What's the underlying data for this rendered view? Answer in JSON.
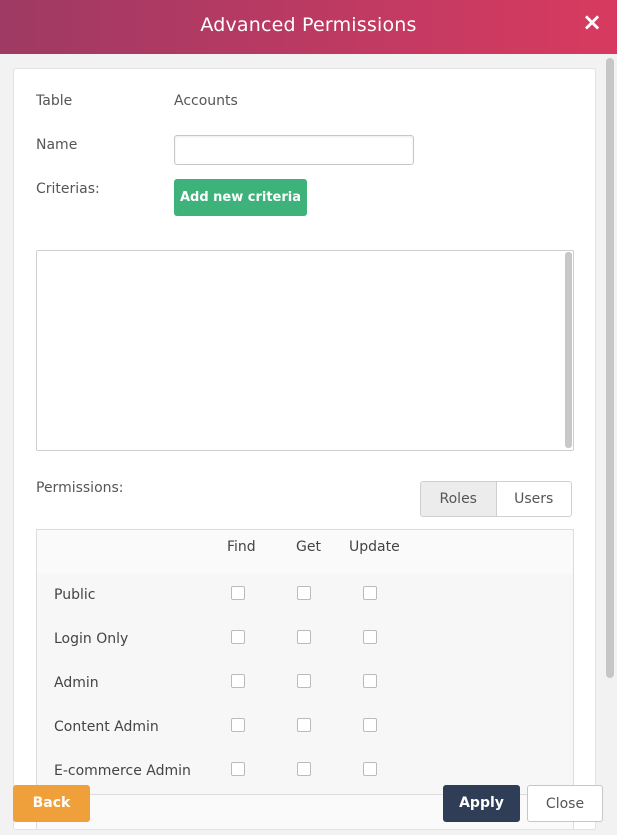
{
  "dialog": {
    "title": "Advanced Permissions",
    "close_icon": "×"
  },
  "form": {
    "table_label": "Table",
    "table_value": "Accounts",
    "name_label": "Name",
    "name_value": "",
    "name_placeholder": "",
    "criterias_label": "Criterias:",
    "add_criteria_label": "Add new criteria"
  },
  "permissions": {
    "label": "Permissions:",
    "toggle": {
      "roles": "Roles",
      "users": "Users",
      "selected": "Roles"
    },
    "columns": [
      "Find",
      "Get",
      "Update"
    ],
    "rows": [
      {
        "label": "Public",
        "find": false,
        "get": false,
        "update": false
      },
      {
        "label": "Login Only",
        "find": false,
        "get": false,
        "update": false
      },
      {
        "label": "Admin",
        "find": false,
        "get": false,
        "update": false
      },
      {
        "label": "Content Admin",
        "find": false,
        "get": false,
        "update": false
      },
      {
        "label": "E-commerce Admin",
        "find": false,
        "get": false,
        "update": false
      }
    ]
  },
  "footer": {
    "back_label": "Back",
    "apply_label": "Apply",
    "close_label": "Close"
  },
  "colors": {
    "header_gradient_start": "#9e3a63",
    "header_gradient_end": "#d83a5f",
    "add_button": "#3db27b",
    "back_button": "#f0a03a",
    "apply_button": "#2f3d57"
  }
}
